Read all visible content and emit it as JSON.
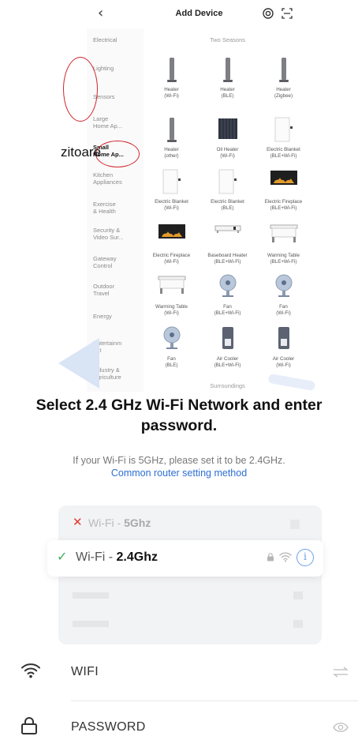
{
  "topbar": {
    "back_glyph": "‹",
    "title": "Add Device"
  },
  "categories": [
    "Electrical",
    "Lighting",
    "Sensors",
    "Large\nHome Ap...",
    "Small\nHome Ap...",
    "Kitchen\nAppliances",
    "Exercise\n& Health",
    "Security &\nVideo Sur...",
    "Gateway\nControl",
    "Outdoor\nTravel",
    "Energy",
    "Entertainm\nent",
    "Industry &\nAgriculture"
  ],
  "selected_category_index": 4,
  "sections": {
    "two_seasons": "Two Seasons",
    "surroundings": "Surroundings"
  },
  "devices": [
    {
      "label": "Heater\n(Wi-Fi)",
      "icon": "heater-tower-icon"
    },
    {
      "label": "Heater\n(BLE)",
      "icon": "heater-tower-icon"
    },
    {
      "label": "Heater\n(Zigbee)",
      "icon": "heater-tower-icon"
    },
    {
      "label": "Heater\n(other)",
      "icon": "heater-tower-icon"
    },
    {
      "label": "Oil Heater\n(Wi-Fi)",
      "icon": "oil-heater-icon"
    },
    {
      "label": "Electric Blanket\n(BLE+Wi-Fi)",
      "icon": "blanket-icon"
    },
    {
      "label": "Electric Blanket\n(Wi-Fi)",
      "icon": "blanket-icon"
    },
    {
      "label": "Electric Blanket\n(BLE)",
      "icon": "blanket-icon"
    },
    {
      "label": "Electric Fireplace\n(BLE+Wi-Fi)",
      "icon": "fireplace-icon"
    },
    {
      "label": "Electric Fireplace\n(Wi-Fi)",
      "icon": "fireplace-icon"
    },
    {
      "label": "Baseboard Heater\n(BLE+Wi-Fi)",
      "icon": "baseboard-heater-icon"
    },
    {
      "label": "Warming Table\n(BLE+Wi-Fi)",
      "icon": "warming-table-icon"
    },
    {
      "label": "Warming Table\n(Wi-Fi)",
      "icon": "warming-table-icon"
    },
    {
      "label": "Fan\n(BLE+Wi-Fi)",
      "icon": "fan-icon"
    },
    {
      "label": "Fan\n(Wi-Fi)",
      "icon": "fan-icon"
    },
    {
      "label": "Fan\n(BLE)",
      "icon": "fan-icon"
    },
    {
      "label": "Air Cooler\n(BLE+Wi-Fi)",
      "icon": "air-cooler-icon"
    },
    {
      "label": "Air Cooler\n(Wi-Fi)",
      "icon": "air-cooler-icon"
    }
  ],
  "side_text": "zitoare",
  "wifi": {
    "headline": "Select 2.4 GHz Wi-Fi Network and enter password.",
    "hint": "If your Wi-Fi is 5GHz, please set it to be 2.4GHz.",
    "link": "Common router setting method",
    "row_5g": {
      "prefix": "Wi-Fi - ",
      "band": "5Ghz",
      "status_glyph": "✕"
    },
    "row_24": {
      "prefix": "Wi-Fi - ",
      "band": "2.4Ghz",
      "status_glyph": "✓",
      "info_glyph": "i"
    }
  },
  "fields": {
    "wifi_label": "WIFI",
    "password_label": "PASSWORD"
  },
  "colors": {
    "accent_link": "#2d6fd2",
    "error": "#e03a2e",
    "success": "#3fae57",
    "annotation_red": "#d2262c"
  }
}
